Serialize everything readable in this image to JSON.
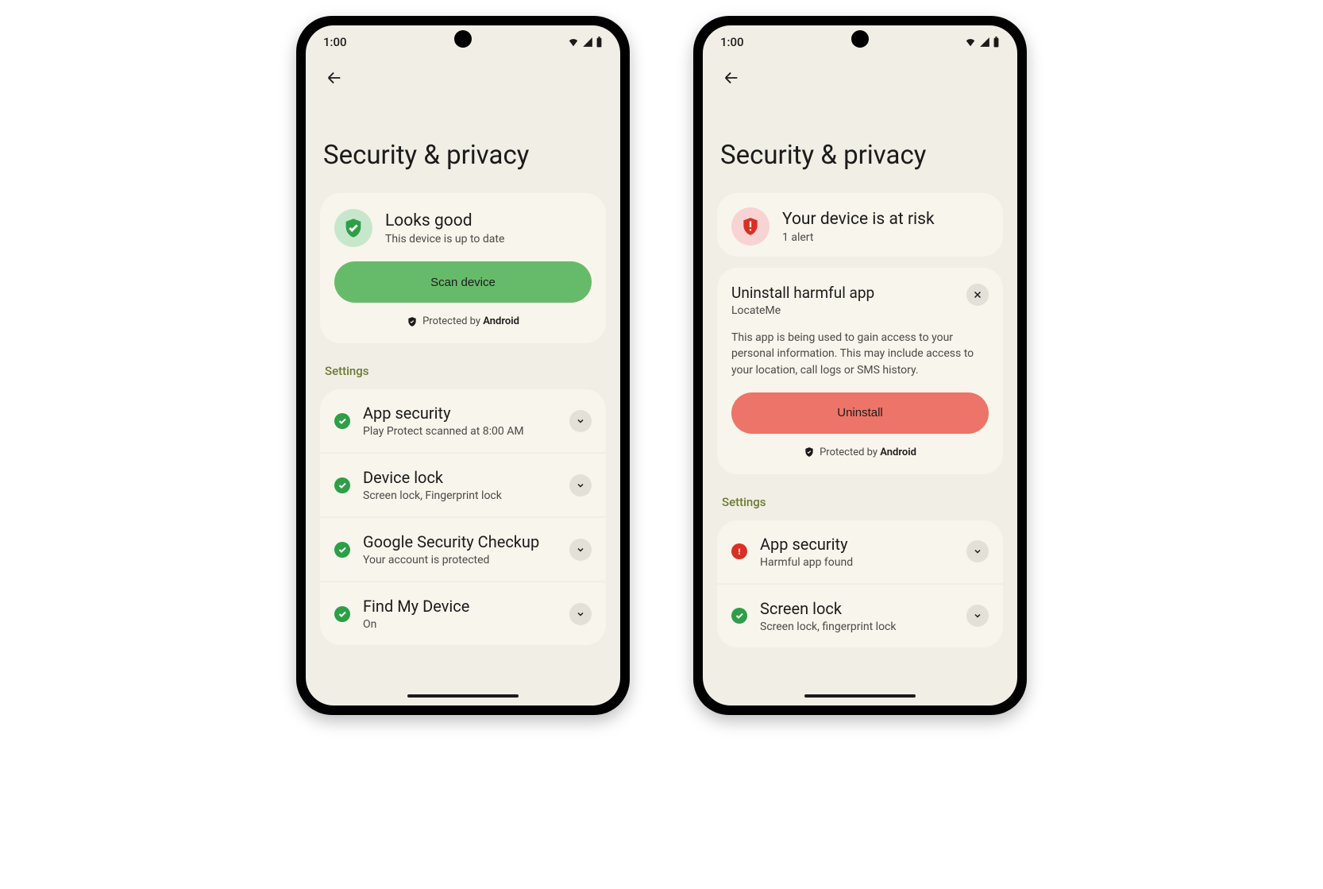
{
  "status_bar": {
    "time": "1:00"
  },
  "page_title": "Security & privacy",
  "protected_prefix": "Protected by ",
  "protected_brand": "Android",
  "settings_label": "Settings",
  "left": {
    "status_title": "Looks good",
    "status_sub": "This device is up to date",
    "button": "Scan device",
    "settings": [
      {
        "title": "App security",
        "sub": "Play Protect scanned at 8:00 AM",
        "state": "ok"
      },
      {
        "title": "Device lock",
        "sub": "Screen lock, Fingerprint lock",
        "state": "ok"
      },
      {
        "title": "Google Security Checkup",
        "sub": "Your account is protected",
        "state": "ok"
      },
      {
        "title": "Find My Device",
        "sub": "On",
        "state": "ok"
      }
    ]
  },
  "right": {
    "status_title": "Your device is at risk",
    "status_sub": "1 alert",
    "alert_title": "Uninstall harmful app",
    "alert_sub": "LocateMe",
    "alert_body": "This app is being used to gain access to your personal information. This may include access to your location, call logs or SMS history.",
    "button": "Uninstall",
    "settings": [
      {
        "title": "App security",
        "sub": "Harmful app found",
        "state": "bad"
      },
      {
        "title": "Screen lock",
        "sub": "Screen lock, fingerprint lock",
        "state": "ok"
      }
    ]
  }
}
